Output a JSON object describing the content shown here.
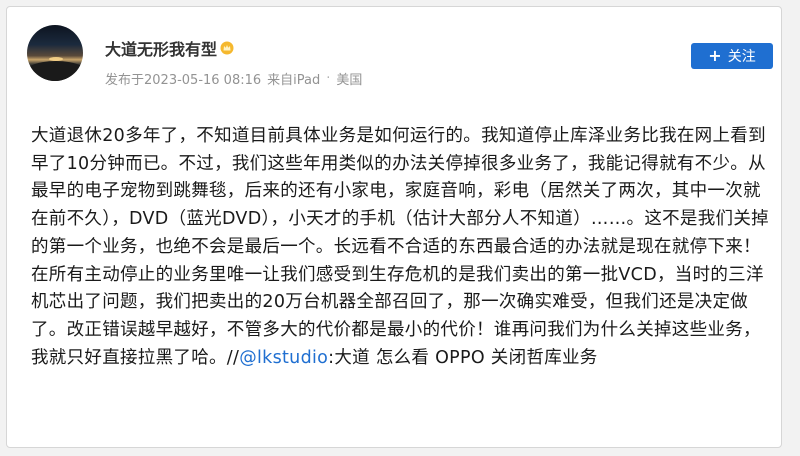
{
  "user": {
    "name": "大道无形我有型",
    "badge_icon": "vip-crown-icon"
  },
  "meta": {
    "posted_label": "发布于2023-05-16 08:16",
    "source": "来自iPad",
    "separator": "·",
    "location": "美国"
  },
  "follow_button": {
    "icon": "+",
    "label": "关注"
  },
  "post": {
    "text_before_mention": "大道退休20多年了，不知道目前具体业务是如何运行的。我知道停止库泽业务比我在网上看到早了10分钟而已。不过，我们这些年用类似的办法关停掉很多业务了，我能记得就有不少。从最早的电子宠物到跳舞毯，后来的还有小家电，家庭音响，彩电（居然关了两次，其中一次就在前不久），DVD（蓝光DVD），小天才的手机（估计大部分人不知道）……。这不是我们关掉的第一个业务，也绝不会是最后一个。长远看不合适的东西最合适的办法就是现在就停下来！在所有主动停止的业务里唯一让我们感受到生存危机的是我们卖出的第一批VCD，当时的三洋机芯出了问题，我们把卖出的20万台机器全部召回了，那一次确实难受，但我们还是决定做了。改正错误越早越好，不管多大的代价都是最小的代价！谁再问我们为什么关掉这些业务，我就只好直接拉黑了哈。//",
    "mention": "@lkstudio",
    "text_after_mention": ":大道 怎么看 OPPO 关闭哲库业务"
  },
  "colors": {
    "accent": "#1f6fd1",
    "text": "#1a1a1a",
    "meta": "#939393"
  }
}
